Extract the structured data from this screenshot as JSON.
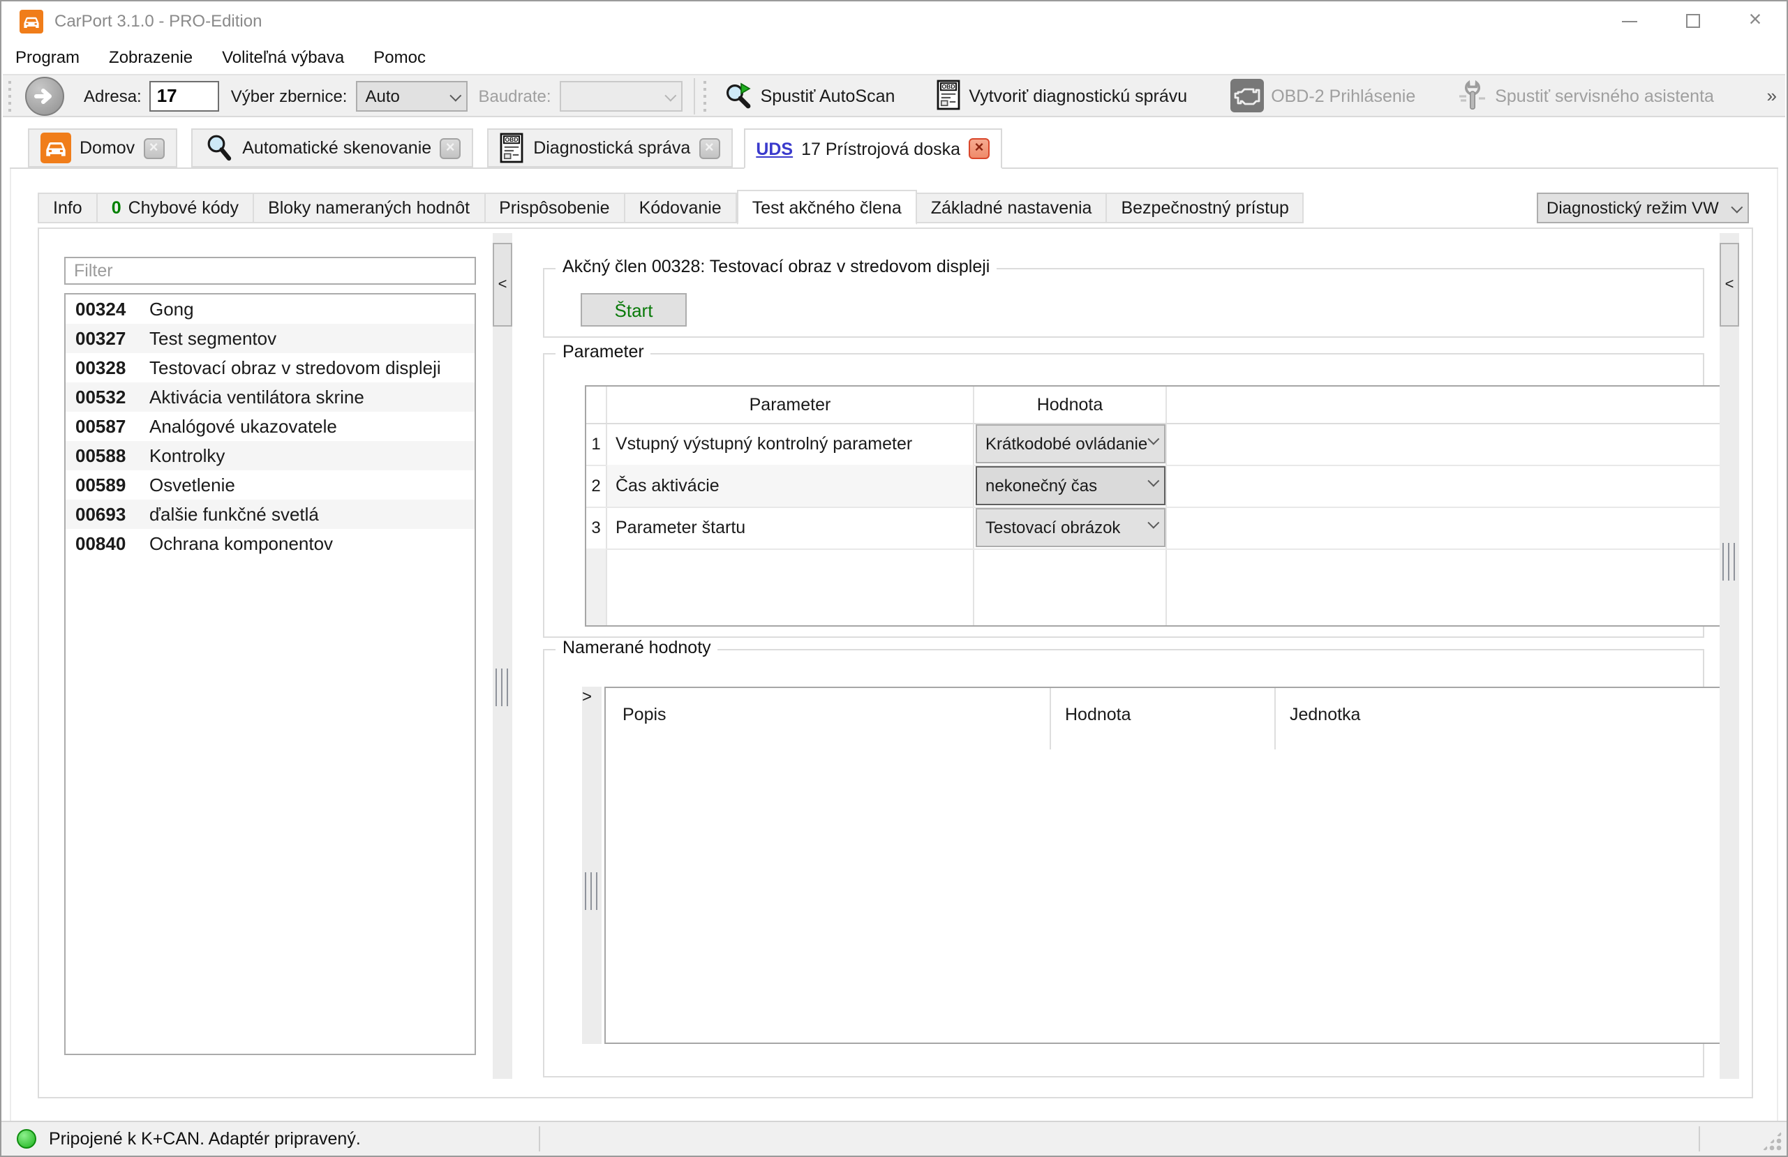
{
  "window": {
    "title": "CarPort 3.1.0 - PRO-Edition"
  },
  "menu": {
    "items": [
      {
        "label": "Program"
      },
      {
        "label": "Zobrazenie"
      },
      {
        "label": "Voliteľná výbava"
      },
      {
        "label": "Pomoc"
      }
    ]
  },
  "toolbar": {
    "address_label": "Adresa:",
    "address_value": "17",
    "bus_label": "Výber zbernice:",
    "bus_value": "Auto",
    "baudrate_label": "Baudrate:",
    "autoscan_label": "Spustiť AutoScan",
    "report_label": "Vytvoriť diagnostickú správu",
    "obd_login_label": "OBD-2 Prihlásenie",
    "service_label": "Spustiť servisného asistenta",
    "overflow": "»"
  },
  "tabs": {
    "items": [
      {
        "label": "Domov"
      },
      {
        "label": "Automatické skenovanie"
      },
      {
        "label": "Diagnostická správa"
      },
      {
        "prefix": "UDS",
        "label": "17 Prístrojová doska"
      }
    ]
  },
  "subtabs": {
    "items": [
      {
        "label": "Info"
      },
      {
        "count": "0",
        "label": "Chybové kódy"
      },
      {
        "label": "Bloky nameraných hodnôt"
      },
      {
        "label": "Prispôsobenie"
      },
      {
        "label": "Kódovanie"
      },
      {
        "label": "Test akčného člena"
      },
      {
        "label": "Základné nastavenia"
      },
      {
        "label": "Bezpečnostný prístup"
      }
    ],
    "mode_select_value": "Diagnostický režim VW"
  },
  "actuators": {
    "filter_placeholder": "Filter",
    "items": [
      {
        "code": "00324",
        "label": "Gong"
      },
      {
        "code": "00327",
        "label": "Test segmentov"
      },
      {
        "code": "00328",
        "label": "Testovací obraz v stredovom displeji"
      },
      {
        "code": "00532",
        "label": "Aktivácia ventilátora skrine"
      },
      {
        "code": "00587",
        "label": "Analógové ukazovatele"
      },
      {
        "code": "00588",
        "label": "Kontrolky"
      },
      {
        "code": "00589",
        "label": "Osvetlenie"
      },
      {
        "code": "00693",
        "label": "ďalšie funkčné svetlá"
      },
      {
        "code": "00840",
        "label": "Ochrana komponentov"
      }
    ]
  },
  "actuator_panel": {
    "title": "Akčný člen 00328: Testovací obraz v stredovom displeji",
    "start_button": "Štart"
  },
  "parameters": {
    "title": "Parameter",
    "col_parameter": "Parameter",
    "col_value": "Hodnota",
    "rows": [
      {
        "num": "1",
        "name": "Vstupný výstupný kontrolný parameter",
        "value": "Krátkodobé ovládanie"
      },
      {
        "num": "2",
        "name": "Čas aktivácie",
        "value": "nekonečný čas"
      },
      {
        "num": "3",
        "name": "Parameter štartu",
        "value": "Testovací obrázok"
      }
    ]
  },
  "measured": {
    "title": "Namerané hodnoty",
    "col_popis": "Popis",
    "col_hodnota": "Hodnota",
    "col_jednotka": "Jednotka"
  },
  "collapse": {
    "left": "<",
    "right": "<",
    "measured": ">"
  },
  "statusbar": {
    "text": "Pripojené k K+CAN. Adaptér pripravený."
  },
  "colors": {
    "accent_orange": "#F07D1A",
    "uds_blue": "#3A3ACC",
    "tab_close_red": "#D9472B",
    "status_green": "#1CB21C",
    "start_button_green": "#0B7A0B",
    "error_count_green": "#008000",
    "toolbar_bg": "#F0F0F0",
    "combo_bg": "#E1E1E1"
  }
}
